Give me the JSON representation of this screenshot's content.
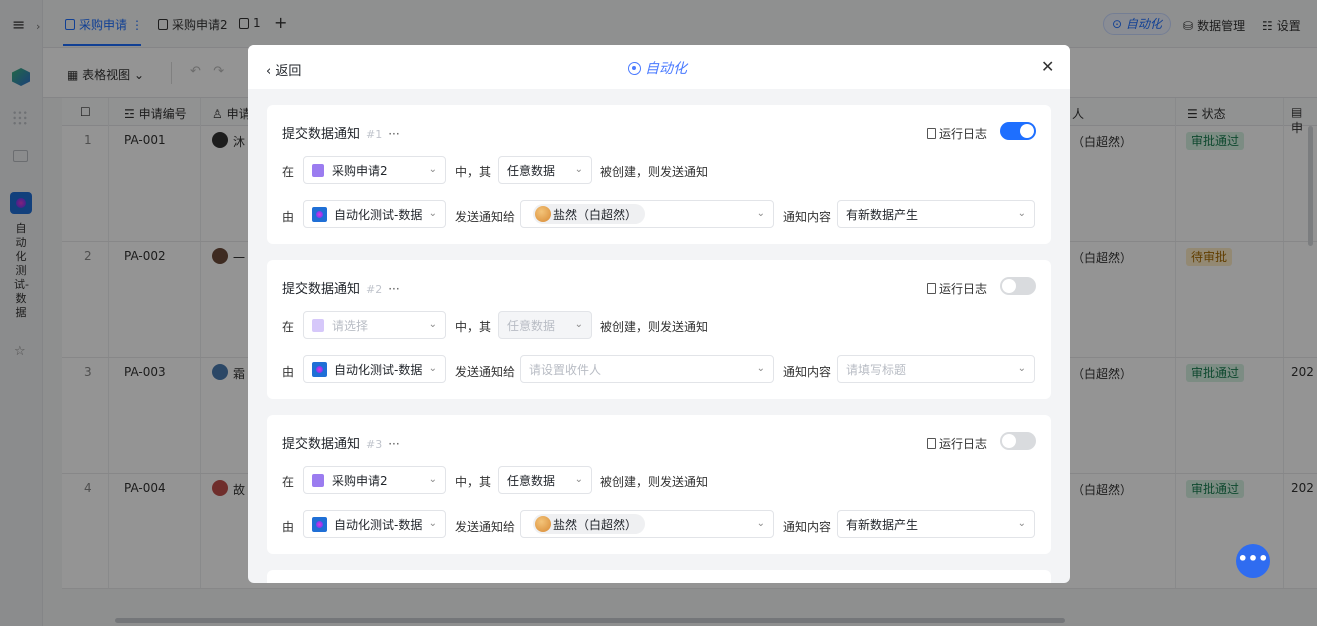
{
  "topbar": {
    "tabs": [
      {
        "label": "采购申请"
      },
      {
        "label": "采购申请2"
      },
      {
        "label": "1"
      }
    ],
    "automation": "自动化",
    "data_manage": "数据管理",
    "settings": "设置"
  },
  "rail": {
    "app_name": "自动化测试-数据"
  },
  "toolbar": {
    "view": "表格视图"
  },
  "table": {
    "columns": [
      "申请编号",
      "申请",
      "人",
      "状态",
      "申"
    ],
    "rows": [
      {
        "num": "1",
        "id": "PA-001",
        "name": "沐",
        "person": "（白超然）",
        "status": "审批通过"
      },
      {
        "num": "2",
        "id": "PA-002",
        "name": "一",
        "person": "（白超然）",
        "status": "待审批"
      },
      {
        "num": "3",
        "id": "PA-003",
        "name": "霜",
        "person": "（白超然）",
        "status": "审批通过",
        "extra": "202"
      },
      {
        "num": "4",
        "id": "PA-004",
        "name": "故",
        "person": "（白超然）",
        "status": "审批通过",
        "extra": "202"
      }
    ],
    "colors": {
      "approved_bg": "#d6f1e2",
      "pending_bg": "#fdecc6"
    }
  },
  "modal": {
    "back": "返回",
    "title": "自动化",
    "cards": [
      {
        "title": "提交数据通知",
        "num": "#1",
        "log": "运行日志",
        "enabled": true,
        "at": "在",
        "form": "采购申请2",
        "mid": "中，其",
        "scope": "任意数据",
        "action": "被创建，则发送通知",
        "by": "由",
        "app": "自动化测试-数据",
        "send_to": "发送通知给",
        "recipient": "盐然（白超然）",
        "content_label": "通知内容",
        "content": "有新数据产生"
      },
      {
        "title": "提交数据通知",
        "num": "#2",
        "log": "运行日志",
        "enabled": false,
        "at": "在",
        "form_placeholder": "请选择",
        "mid": "中，其",
        "scope": "任意数据",
        "action": "被创建，则发送通知",
        "by": "由",
        "app": "自动化测试-数据",
        "send_to": "发送通知给",
        "recipient_placeholder": "请设置收件人",
        "content_label": "通知内容",
        "content_placeholder": "请填写标题"
      },
      {
        "title": "提交数据通知",
        "num": "#3",
        "log": "运行日志",
        "enabled": false,
        "at": "在",
        "form": "采购申请2",
        "mid": "中，其",
        "scope": "任意数据",
        "action": "被创建，则发送通知",
        "by": "由",
        "app": "自动化测试-数据",
        "send_to": "发送通知给",
        "recipient": "盐然（白超然）",
        "content_label": "通知内容",
        "content": "有新数据产生"
      }
    ]
  }
}
